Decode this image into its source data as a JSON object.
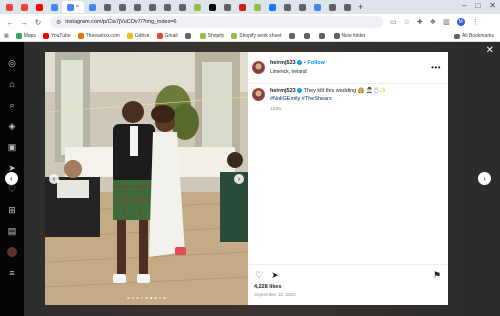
{
  "browser": {
    "tabs": [
      {
        "icon": "mail-icon",
        "color": "#ea4335"
      },
      {
        "icon": "mail-icon",
        "color": "#ea4335"
      },
      {
        "icon": "youtube-icon",
        "color": "#ff0000"
      },
      {
        "icon": "doc-icon",
        "color": "#4285f4"
      },
      {
        "icon": "google-icon",
        "color": "#4285f4",
        "active": true
      },
      {
        "icon": "doc-icon",
        "color": "#4285f4"
      },
      {
        "icon": "generic-icon",
        "color": "#5f6368"
      },
      {
        "icon": "generic-icon",
        "color": "#5f6368"
      },
      {
        "icon": "generic-icon",
        "color": "#5f6368"
      },
      {
        "icon": "generic-icon",
        "color": "#5f6368"
      },
      {
        "icon": "generic-icon",
        "color": "#5f6368"
      },
      {
        "icon": "generic-icon",
        "color": "#5f6368"
      },
      {
        "icon": "shopify-icon",
        "color": "#95bf47"
      },
      {
        "icon": "threads-icon",
        "color": "#000000"
      },
      {
        "icon": "generic-icon",
        "color": "#5f6368"
      },
      {
        "icon": "red-icon",
        "color": "#c5221f"
      },
      {
        "icon": "shopify-icon",
        "color": "#95bf47"
      },
      {
        "icon": "facebook-icon",
        "color": "#1877f2"
      },
      {
        "icon": "generic-icon",
        "color": "#5f6368"
      },
      {
        "icon": "generic-icon",
        "color": "#5f6368"
      },
      {
        "icon": "doc-icon",
        "color": "#4285f4"
      },
      {
        "icon": "generic-icon",
        "color": "#5f6368"
      },
      {
        "icon": "generic-icon",
        "color": "#5f6368"
      }
    ],
    "url": "instagram.com/p/Cia7jVuCOv7/?img_index=6",
    "bookmarks": [
      {
        "label": "Maps",
        "color": "#34a853"
      },
      {
        "label": "YouTube",
        "color": "#ff0000"
      },
      {
        "label": "Theeastco.com",
        "color": "#e8710a"
      },
      {
        "label": "Gdrive",
        "color": "#fbbc04"
      },
      {
        "label": "Gmail",
        "color": "#ea4335"
      },
      {
        "label": "",
        "color": "#5f6368"
      },
      {
        "label": "Shopify",
        "color": "#95bf47"
      },
      {
        "label": "Shopify work sheet",
        "color": "#95bf47"
      },
      {
        "label": "",
        "color": "#5f6368"
      },
      {
        "label": "",
        "color": "#5f6368"
      },
      {
        "label": "",
        "color": "#5f6368"
      },
      {
        "label": "New folder",
        "color": "#5f6368"
      }
    ],
    "all_bookmarks": "All Bookmarks",
    "profile_initial": "M"
  },
  "post": {
    "username": "heirmj523",
    "follow": "Follow",
    "location": "Limerick, Ireland",
    "caption_text": "They kilt this wedding 👸 🤵🏻‍♂️💍✨",
    "caption_tags": "#NoliGEmily #TheShears",
    "caption_age": "128w",
    "likes": "4,228 likes",
    "date": "September 12, 2022",
    "carousel_count": 9,
    "carousel_index": 6
  },
  "colors": {
    "accent": "#0095f6",
    "verified": "#0095f6"
  }
}
